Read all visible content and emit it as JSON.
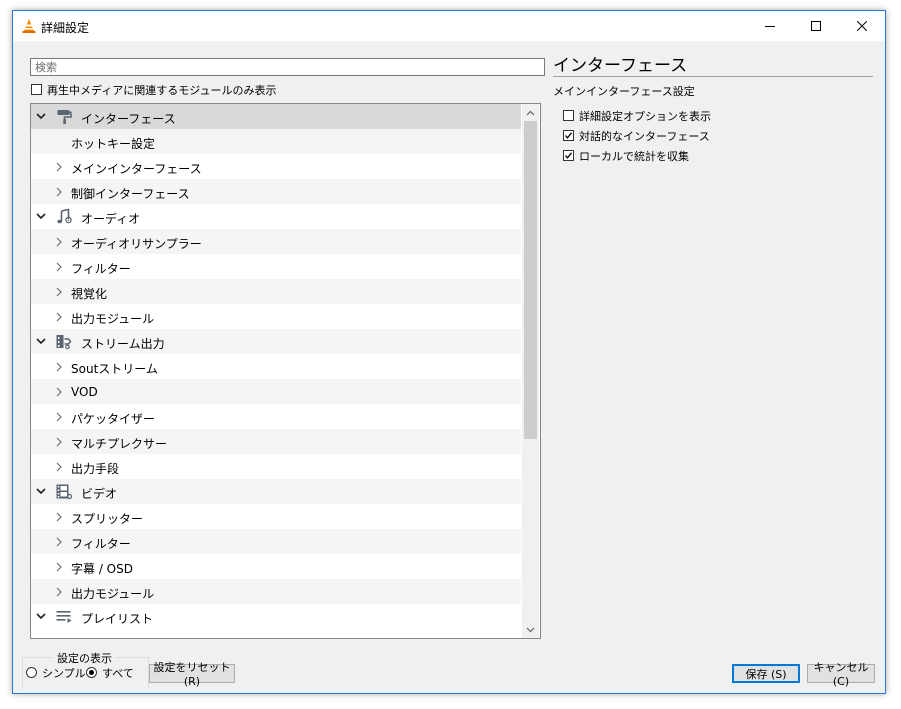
{
  "window": {
    "title": "詳細設定"
  },
  "search": {
    "placeholder": "検索"
  },
  "filter_checkbox": {
    "label": "再生中メディアに関連するモジュールのみ表示",
    "checked": false
  },
  "tree": {
    "items": [
      {
        "label": "インターフェース",
        "level": 0,
        "expanded": true,
        "icon": "paint-roller-icon",
        "selected": true
      },
      {
        "label": "ホットキー設定",
        "level": 1,
        "leaf": true
      },
      {
        "label": "メインインターフェース",
        "level": 1
      },
      {
        "label": "制御インターフェース",
        "level": 1
      },
      {
        "label": "オーディオ",
        "level": 0,
        "expanded": true,
        "icon": "music-note-icon"
      },
      {
        "label": "オーディオリサンプラー",
        "level": 1
      },
      {
        "label": "フィルター",
        "level": 1
      },
      {
        "label": "視覚化",
        "level": 1
      },
      {
        "label": "出力モジュール",
        "level": 1
      },
      {
        "label": "ストリーム出力",
        "level": 0,
        "expanded": true,
        "icon": "stream-output-icon"
      },
      {
        "label": "Soutストリーム",
        "level": 1
      },
      {
        "label": "VOD",
        "level": 1
      },
      {
        "label": "パケッタイザー",
        "level": 1
      },
      {
        "label": "マルチプレクサー",
        "level": 1
      },
      {
        "label": "出力手段",
        "level": 1
      },
      {
        "label": "ビデオ",
        "level": 0,
        "expanded": true,
        "icon": "video-film-icon"
      },
      {
        "label": "スプリッター",
        "level": 1
      },
      {
        "label": "フィルター",
        "level": 1
      },
      {
        "label": "字幕 / OSD",
        "level": 1
      },
      {
        "label": "出力モジュール",
        "level": 1
      },
      {
        "label": "プレイリスト",
        "level": 0,
        "expanded": true,
        "icon": "playlist-icon"
      }
    ]
  },
  "panel": {
    "title": "インターフェース",
    "subtitle": "メインインターフェース設定",
    "options": [
      {
        "label": "詳細設定オプションを表示",
        "checked": false
      },
      {
        "label": "対話的なインターフェース",
        "checked": true
      },
      {
        "label": "ローカルで統計を収集",
        "checked": true
      }
    ]
  },
  "display_group": {
    "legend": "設定の表示",
    "simple_label": "シンプル",
    "all_label": "すべて",
    "selected": "all"
  },
  "buttons": {
    "reset": "設定をリセット (R)",
    "save": "保存 (S)",
    "cancel": "キャンセル (C)"
  },
  "colors": {
    "accent_border": "#2b79d6",
    "selected_row": "#d9d9d9",
    "default_button_border": "#0078d7"
  }
}
